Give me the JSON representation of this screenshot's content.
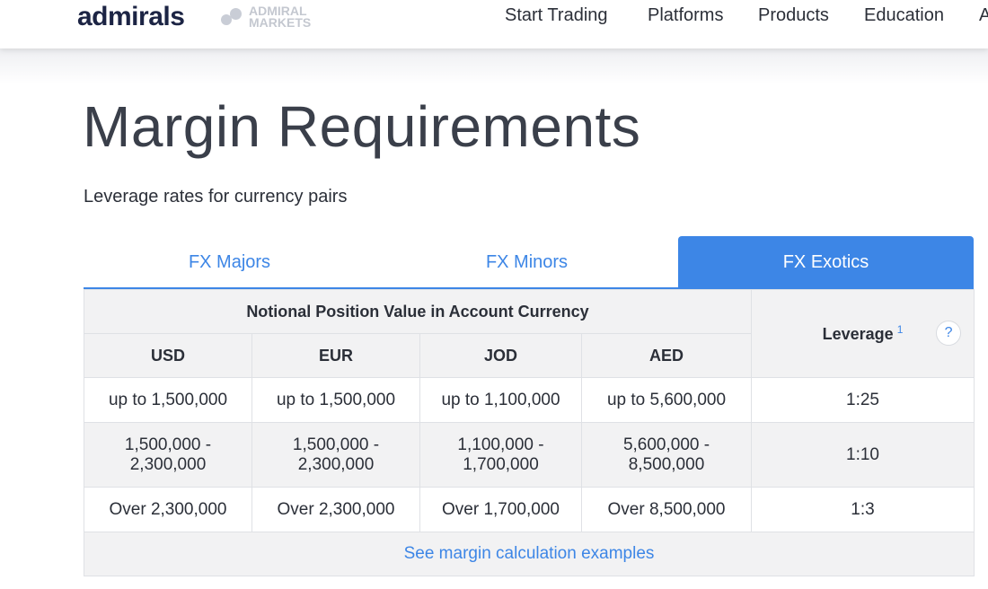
{
  "header": {
    "logo": "admirals",
    "sublogo_line1": "ADMIRAL",
    "sublogo_line2": "MARKETS",
    "nav": [
      "Start Trading",
      "Platforms",
      "Products",
      "Education",
      "A"
    ]
  },
  "page": {
    "title": "Margin Requirements",
    "subtitle": "Leverage rates for currency pairs"
  },
  "tabs": [
    {
      "label": "FX Majors",
      "active": false
    },
    {
      "label": "FX Minors",
      "active": false
    },
    {
      "label": "FX Exotics",
      "active": true
    }
  ],
  "table": {
    "group_header": "Notional Position Value in Account Currency",
    "leverage_header": "Leverage",
    "leverage_footnote": "1",
    "help": "?",
    "columns": [
      "USD",
      "EUR",
      "JOD",
      "AED"
    ],
    "rows": [
      {
        "cells": [
          "up to 1,500,000",
          "up to 1,500,000",
          "up to 1,100,000",
          "up to 5,600,000"
        ],
        "leverage": "1:25"
      },
      {
        "cells": [
          "1,500,000 - 2,300,000",
          "1,500,000 - 2,300,000",
          "1,100,000 - 1,700,000",
          "5,600,000 - 8,500,000"
        ],
        "leverage": "1:10"
      },
      {
        "cells": [
          "Over 2,300,000",
          "Over 2,300,000",
          "Over 1,700,000",
          "Over 8,500,000"
        ],
        "leverage": "1:3"
      }
    ],
    "footer_link": "See margin calculation examples"
  },
  "colors": {
    "accent": "#3d86e6",
    "logo": "#1c2444",
    "row_alt": "#f2f2f3"
  }
}
